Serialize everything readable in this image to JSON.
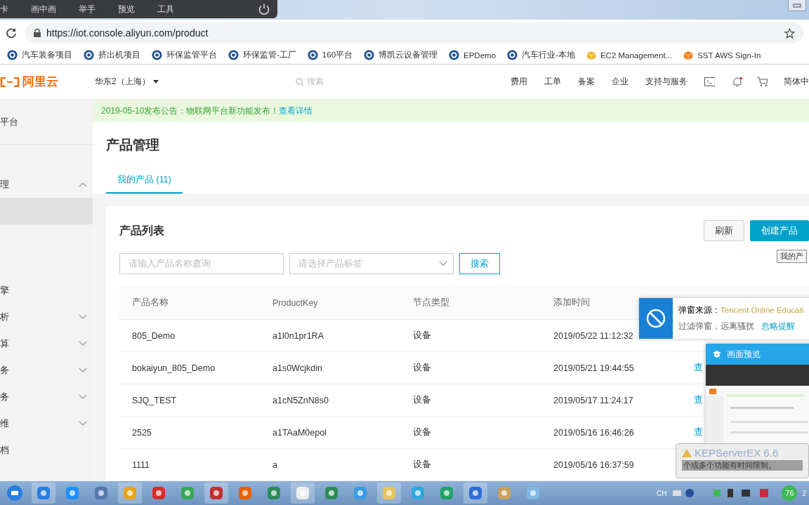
{
  "recorder_bar": {
    "items": [
      "卡",
      "画中画",
      "举手",
      "预览",
      "工具"
    ]
  },
  "browser": {
    "url": "https://iot.console.aliyun.com/product",
    "bookmarks": [
      {
        "label": "汽车装备项目",
        "kind": "gear"
      },
      {
        "label": "挤出机项目",
        "kind": "gear"
      },
      {
        "label": "环保监管平台",
        "kind": "gear"
      },
      {
        "label": "环保监管-工厂",
        "kind": "gear"
      },
      {
        "label": "160平台",
        "kind": "gear"
      },
      {
        "label": "博凯云设备管理",
        "kind": "gear"
      },
      {
        "label": "EPDemo",
        "kind": "gear"
      },
      {
        "label": "汽车行业-本地",
        "kind": "gear"
      },
      {
        "label": "EC2 Management...",
        "kind": "box"
      },
      {
        "label": "SST AWS Sign-In",
        "kind": "hexbox"
      }
    ]
  },
  "header": {
    "logo": "阿里云",
    "region": "华东2（上海）",
    "search_placeholder": "搜索",
    "nav": [
      "费用",
      "工单",
      "备案",
      "企业",
      "支持与服务"
    ],
    "language": "简体中"
  },
  "sidebar": {
    "items": [
      {
        "label": "平台",
        "kind": "link",
        "selected": false
      },
      {
        "label": "理",
        "kind": "group",
        "expanded": true,
        "selected": false
      },
      {
        "kind": "blank",
        "selected": true
      },
      {
        "label": "擎",
        "kind": "link",
        "selected": false
      },
      {
        "label": "析",
        "kind": "group",
        "expanded": false,
        "selected": false
      },
      {
        "label": "算",
        "kind": "group",
        "expanded": false,
        "selected": false
      },
      {
        "label": "务",
        "kind": "group",
        "expanded": false,
        "selected": false
      },
      {
        "label": "务",
        "kind": "group",
        "expanded": false,
        "selected": false
      },
      {
        "label": "维",
        "kind": "group",
        "expanded": false,
        "selected": false
      },
      {
        "label": "档",
        "kind": "link",
        "selected": false
      }
    ]
  },
  "notice": {
    "text": "2019-05-10发布公告：物联网平台新功能发布！",
    "link": "查看详情"
  },
  "page_title": "产品管理",
  "tabs": [
    {
      "label": "我的产品 (11)",
      "selected": true
    }
  ],
  "card": {
    "title": "产品列表",
    "refresh_button": "刷新",
    "create_button": "创建产品",
    "name_field": {
      "placeholder": "请输入产品名称查询"
    },
    "tag_select": {
      "placeholder": "请选择产品标签"
    },
    "search_button": "搜索",
    "table": {
      "columns": [
        "产品名称",
        "ProductKey",
        "节点类型",
        "添加时间"
      ],
      "rows": [
        {
          "name": "805_Demo",
          "key": "a1l0n1pr1RA",
          "node_type": "设备",
          "added": "2019/05/22 11:12:32"
        },
        {
          "name": "bokaiyun_805_Demo",
          "key": "a1s0Wcjkdin",
          "node_type": "设备",
          "added": "2019/05/21 19:44:55",
          "action": "查"
        },
        {
          "name": "SJQ_TEST",
          "key": "a1cN5ZnN8s0",
          "node_type": "设备",
          "added": "2019/05/17 11:24:17",
          "action": "查"
        },
        {
          "name": "2525",
          "key": "a1TAaM0epol",
          "node_type": "设备",
          "added": "2019/05/16 16:46:26",
          "action": "查"
        },
        {
          "name": "1111",
          "key": "a",
          "node_type": "设备",
          "added": "2019/05/16 16:37:59"
        }
      ]
    }
  },
  "tooltip": "我的产",
  "popup": {
    "source_label": "弹窗来源：",
    "source": "Tencent Online Educati",
    "message": "过滤弹窗，远离骚扰",
    "ignore_link": "忽略提醒"
  },
  "preview_window": {
    "title": "画面预览"
  },
  "toast": {
    "title": "KEPServerEX 6.6",
    "message": "个或多个功能有时间限制。"
  },
  "taskbar": {
    "language": "CH",
    "badge": "76",
    "clock": "2"
  }
}
